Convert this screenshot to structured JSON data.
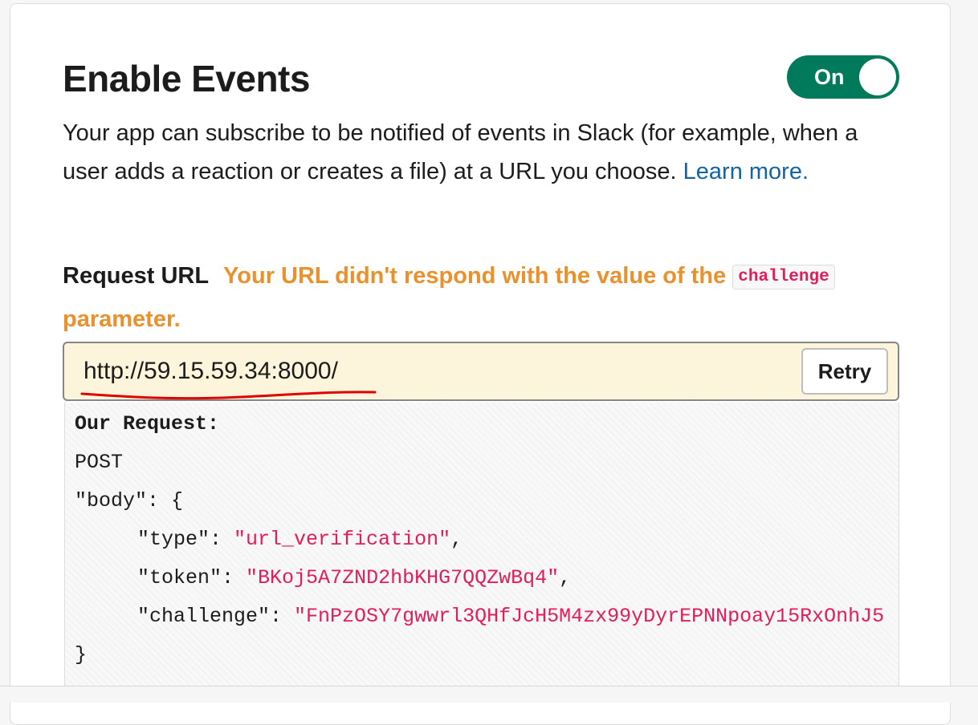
{
  "section": {
    "title": "Enable Events",
    "toggle": {
      "label": "On",
      "state": "on",
      "color": "#007a5a"
    },
    "description": {
      "text": "Your app can subscribe to be notified of events in Slack (for example, when a user adds a reaction or creates a file) at a URL you choose.",
      "link": "Learn more."
    }
  },
  "request_url": {
    "label": "Request URL",
    "warning_before": "Your URL didn't respond with the value of the",
    "warning_code": "challenge",
    "warning_after": "parameter.",
    "value": "http://59.15.59.34:8000/",
    "retry_label": "Retry"
  },
  "our_request": {
    "heading": "Our Request:",
    "method": "POST",
    "body_open": "\"body\": {",
    "fields": [
      {
        "key": "\"type\"",
        "value": "\"url_verification\"",
        "trail": ","
      },
      {
        "key": "\"token\"",
        "value": "\"BKoj5A7ZND2hbKHG7QQZwBq4\"",
        "trail": ","
      },
      {
        "key": "\"challenge\"",
        "value": "\"FnPzOSY7gwwrl3QHfJcH5M4zx99yDyrEPNNpoay15RxOnhJ5",
        "trail": ""
      }
    ],
    "body_close": "}"
  },
  "colors": {
    "warning": "#e8912d",
    "link": "#1264a3",
    "string": "#e01e5a",
    "url_bg": "#fcf4db",
    "annotation": "#e00000"
  }
}
